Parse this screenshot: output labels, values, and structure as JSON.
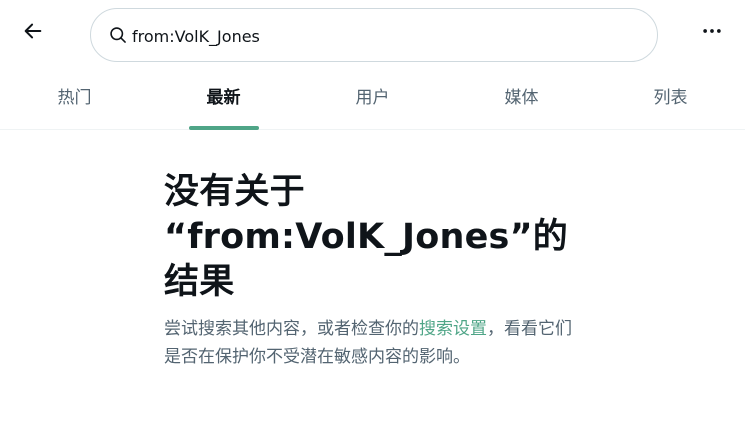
{
  "search": {
    "query": "from:VolK_Jones"
  },
  "tabs": [
    {
      "label": "热门",
      "active": false
    },
    {
      "label": "最新",
      "active": true
    },
    {
      "label": "用户",
      "active": false
    },
    {
      "label": "媒体",
      "active": false
    },
    {
      "label": "列表",
      "active": false
    }
  ],
  "empty_state": {
    "title_line1": "没有关于",
    "title_line2": "“from:VolK_Jones”的",
    "title_line3": "结果",
    "desc_before": "尝试搜索其他内容，或者检查你的",
    "desc_link": "搜索设置",
    "desc_after": "，看看它们是否在保护你不受潜在敏感内容的影响。"
  },
  "colors": {
    "accent": "#4fa587",
    "text_primary": "#0f1419",
    "text_secondary": "#536471",
    "border": "#cfd9de"
  },
  "icons": {
    "back": "arrow-left-icon",
    "search": "magnifier-icon",
    "more": "more-horizontal-icon"
  }
}
